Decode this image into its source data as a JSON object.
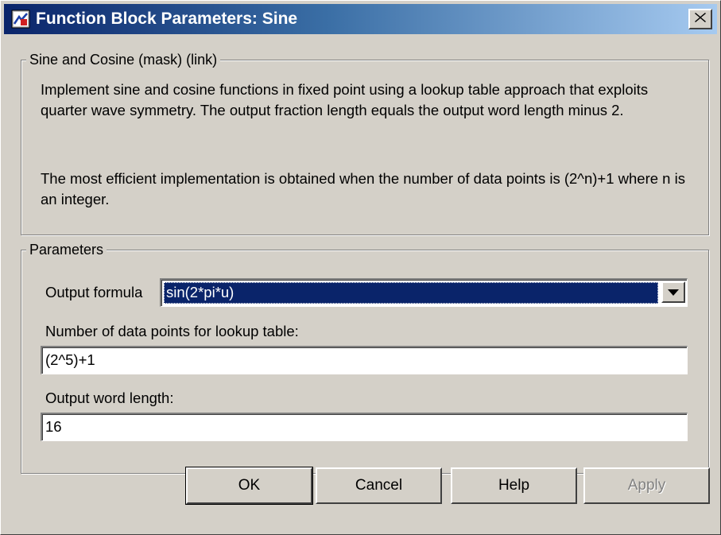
{
  "window": {
    "title": "Function Block Parameters: Sine",
    "close_label": "×"
  },
  "mask_group": {
    "legend": "Sine and Cosine (mask) (link)",
    "description_1": "Implement sine and cosine functions in fixed point using a lookup table approach that exploits quarter wave symmetry. The output fraction length equals the output word length minus 2.",
    "description_2": "The most efficient implementation is obtained when the number of data points is (2^n)+1 where n is an integer."
  },
  "parameters_group": {
    "legend": "Parameters",
    "output_formula_label": "Output formula",
    "output_formula_value": "sin(2*pi*u)",
    "data_points_label": "Number of data points for lookup table:",
    "data_points_value": "(2^5)+1",
    "word_length_label": "Output word length:",
    "word_length_value": "16"
  },
  "buttons": {
    "ok": "OK",
    "cancel": "Cancel",
    "help": "Help",
    "apply": "Apply"
  },
  "colors": {
    "title_bar_start": "#0a246a",
    "title_bar_end": "#a6caf0",
    "dialog_face": "#d4d0c8",
    "selection": "#0a246a"
  },
  "icons": {
    "title_icon": "simulink-block-icon",
    "close_icon": "close-icon",
    "dropdown_icon": "chevron-down-icon"
  }
}
